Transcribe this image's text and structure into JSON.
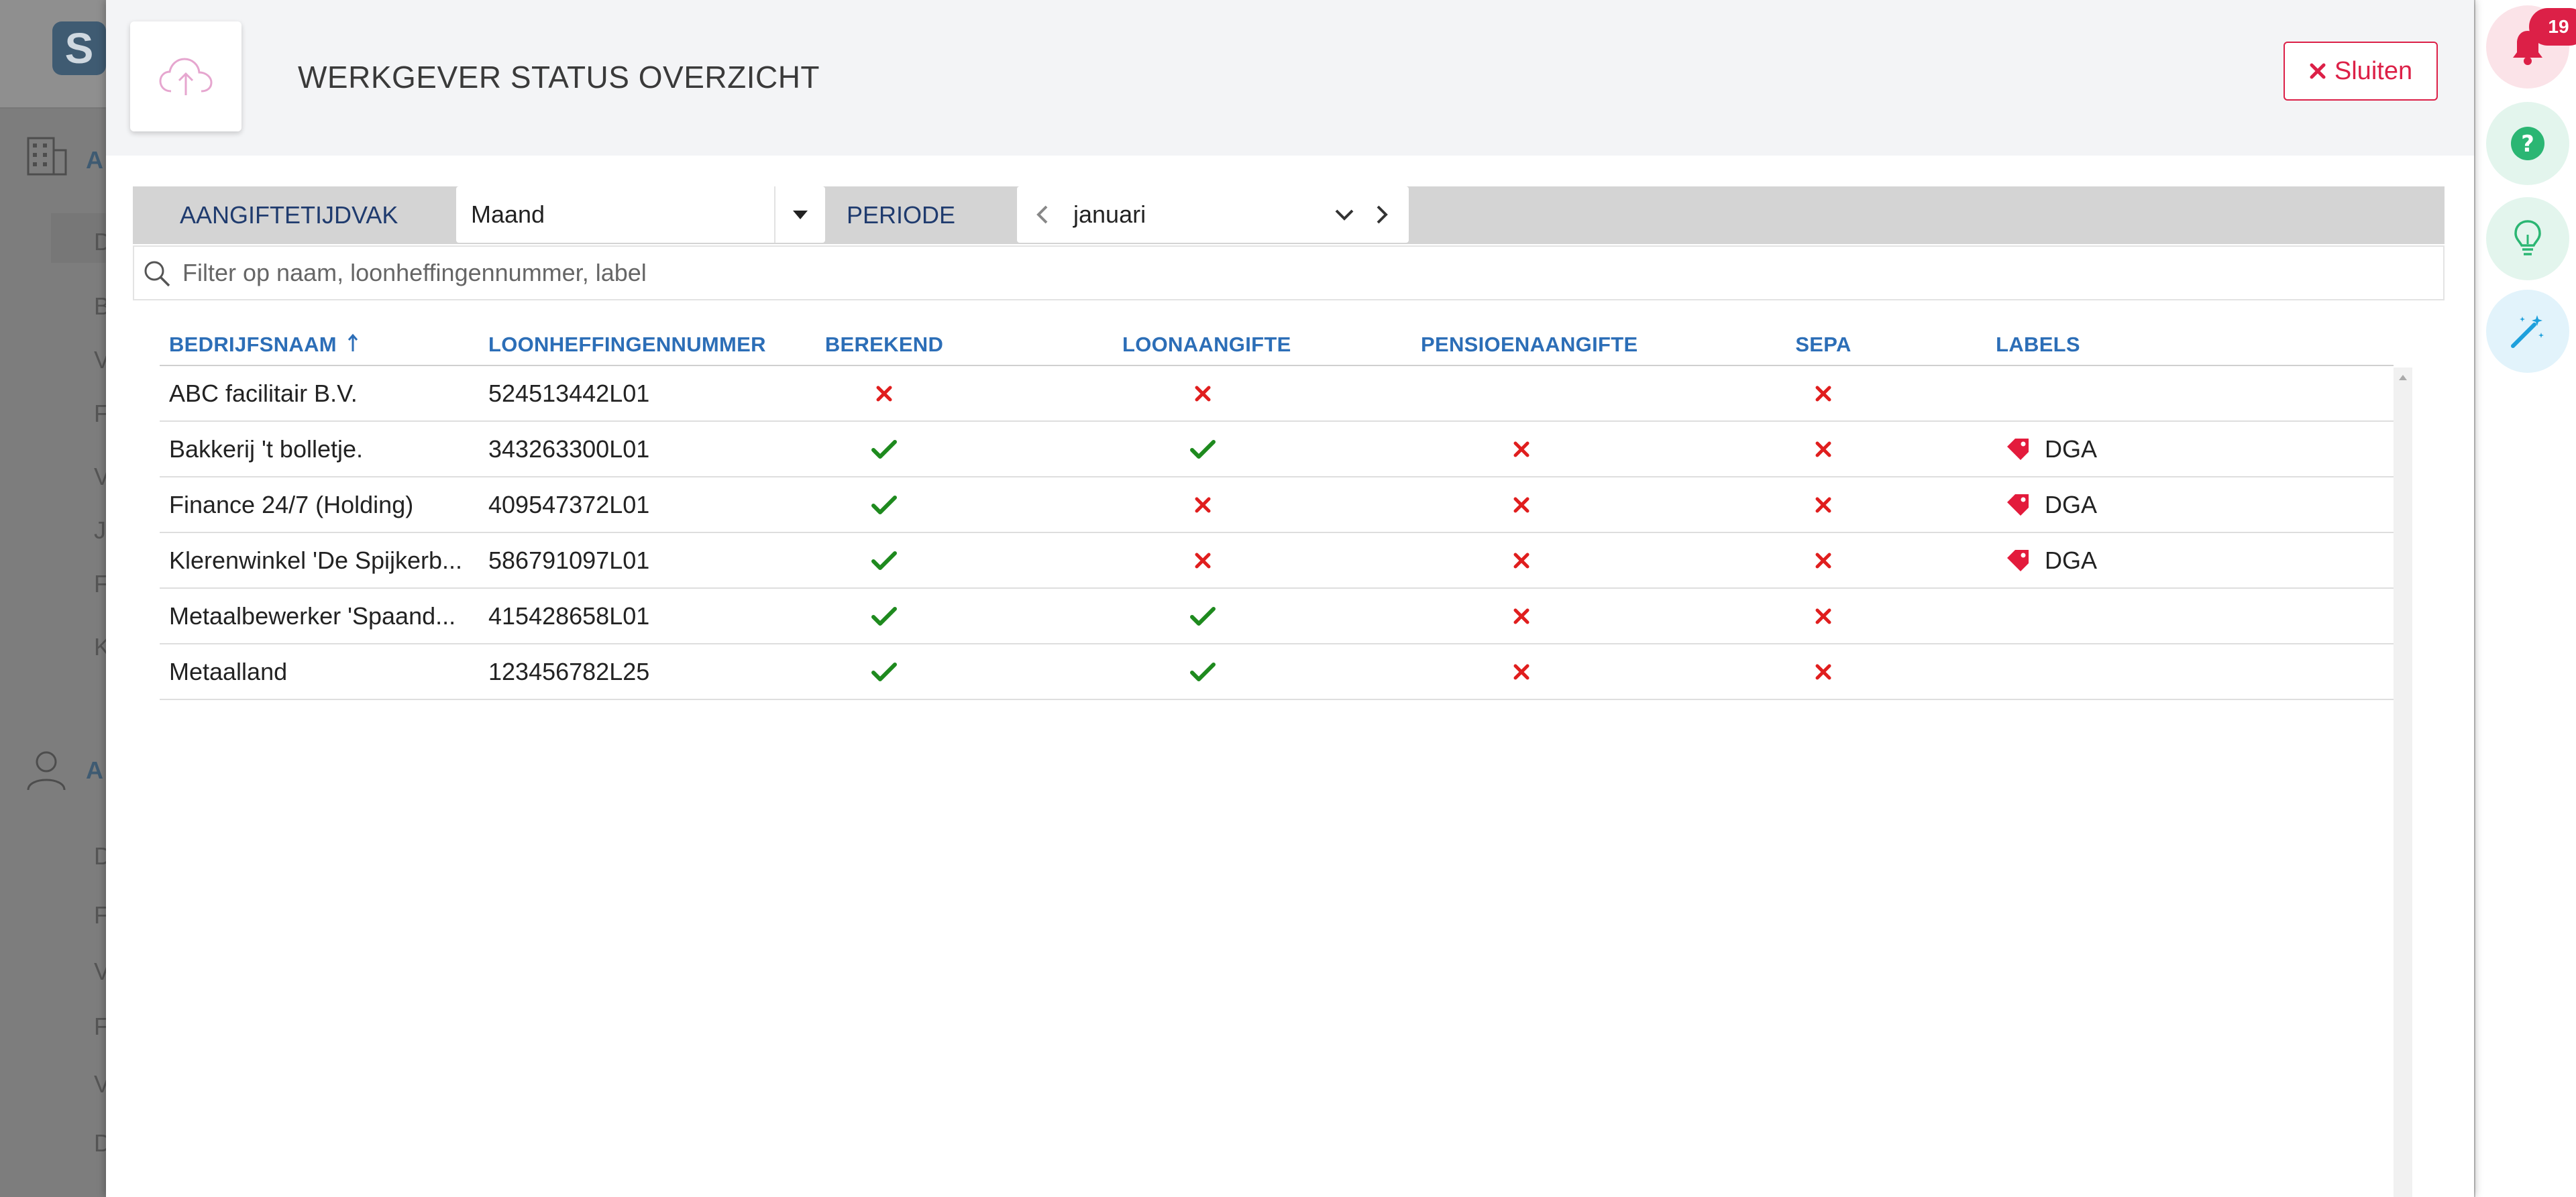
{
  "background": {
    "logo_letter": "S",
    "nav_letters": [
      "A",
      "D",
      "B",
      "V",
      "F",
      "V",
      "J",
      "F",
      "K",
      "A",
      "D",
      "F",
      "V",
      "F",
      "V",
      "D"
    ]
  },
  "right_rail": {
    "notification_count": "19",
    "items": [
      "bell-icon",
      "help-icon",
      "lightbulb-icon",
      "magic-wand-icon"
    ]
  },
  "modal": {
    "title": "WERKGEVER STATUS OVERZICHT",
    "close_label": "Sluiten",
    "upload_icon": "cloud-upload-icon"
  },
  "filters": {
    "period_type_label": "AANGIFTETIJDVAK",
    "period_type_value": "Maand",
    "period_label": "PERIODE",
    "period_value": "januari"
  },
  "search": {
    "placeholder": "Filter op naam, loonheffingennummer, label"
  },
  "table": {
    "sort_column": "BEDRIJFSNAAM",
    "sort_direction": "ascending",
    "columns": [
      "BEDRIJFSNAAM",
      "LOONHEFFINGENNUMMER",
      "BEREKEND",
      "LOONAANGIFTE",
      "PENSIOENAANGIFTE",
      "SEPA",
      "LABELS"
    ],
    "rows": [
      {
        "name": "ABC facilitair B.V.",
        "number": "524513442L01",
        "berekend": "cross",
        "loonaangifte": "cross",
        "pensioenaangifte": "",
        "sepa": "cross",
        "label": ""
      },
      {
        "name": "Bakkerij 't bolletje.",
        "number": "343263300L01",
        "berekend": "check",
        "loonaangifte": "check",
        "pensioenaangifte": "cross",
        "sepa": "cross",
        "label": "DGA"
      },
      {
        "name": "Finance 24/7 (Holding)",
        "number": "409547372L01",
        "berekend": "check",
        "loonaangifte": "cross",
        "pensioenaangifte": "cross",
        "sepa": "cross",
        "label": "DGA"
      },
      {
        "name": "Klerenwinkel 'De Spijkerb...",
        "number": "586791097L01",
        "berekend": "check",
        "loonaangifte": "cross",
        "pensioenaangifte": "cross",
        "sepa": "cross",
        "label": "DGA"
      },
      {
        "name": "Metaalbewerker 'Spaand...",
        "number": "415428658L01",
        "berekend": "check",
        "loonaangifte": "check",
        "pensioenaangifte": "cross",
        "sepa": "cross",
        "label": ""
      },
      {
        "name": "Metaalland",
        "number": "123456782L25",
        "berekend": "check",
        "loonaangifte": "check",
        "pensioenaangifte": "cross",
        "sepa": "cross",
        "label": ""
      }
    ]
  },
  "colors": {
    "accent": "#2c6eb7",
    "danger": "#dc2047",
    "success": "#1e8a1e",
    "cross": "#e01e1e",
    "tag": "#e31b3c"
  }
}
